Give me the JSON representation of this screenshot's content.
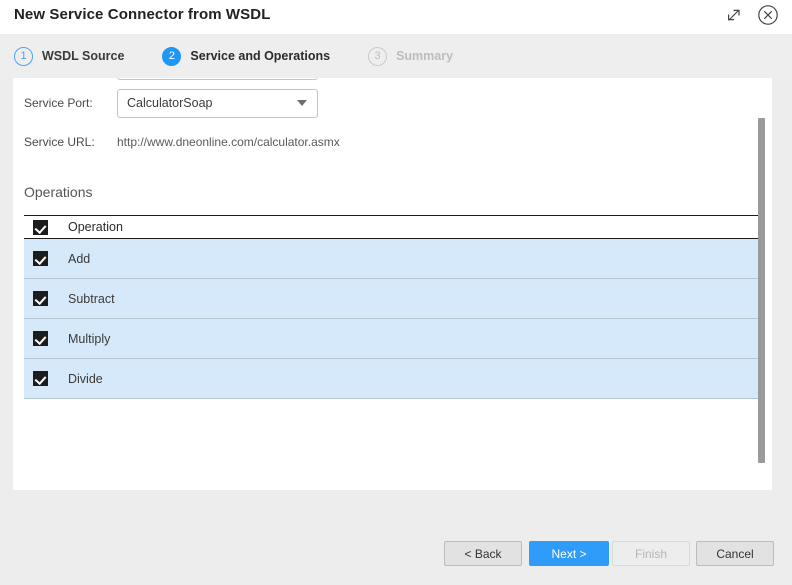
{
  "window": {
    "title": "New Service Connector from WSDL",
    "expand_icon": "expand-diagonal-icon",
    "close_icon": "close-circle-icon"
  },
  "steps": [
    {
      "number": "1",
      "label": "WSDL Source",
      "state": "done"
    },
    {
      "number": "2",
      "label": "Service and Operations",
      "state": "active"
    },
    {
      "number": "3",
      "label": "Summary",
      "state": "pending"
    }
  ],
  "form": {
    "service_port_label": "Service Port:",
    "service_port_value": "CalculatorSoap",
    "service_url_label": "Service URL:",
    "service_url_value": "http://www.dneonline.com/calculator.asmx"
  },
  "operations": {
    "section_title": "Operations",
    "header": {
      "checked": true,
      "column": "Operation"
    },
    "rows": [
      {
        "name": "Add",
        "checked": true
      },
      {
        "name": "Subtract",
        "checked": true
      },
      {
        "name": "Multiply",
        "checked": true
      },
      {
        "name": "Divide",
        "checked": true
      }
    ]
  },
  "footer": {
    "back": "< Back",
    "next": "Next >",
    "finish": "Finish",
    "cancel": "Cancel"
  },
  "colors": {
    "accent": "#2196f3",
    "primary_button": "#2e9cf8",
    "row_highlight": "#d6e9fa",
    "step_bar": "#eeeeee",
    "window_background": "#ededed"
  }
}
